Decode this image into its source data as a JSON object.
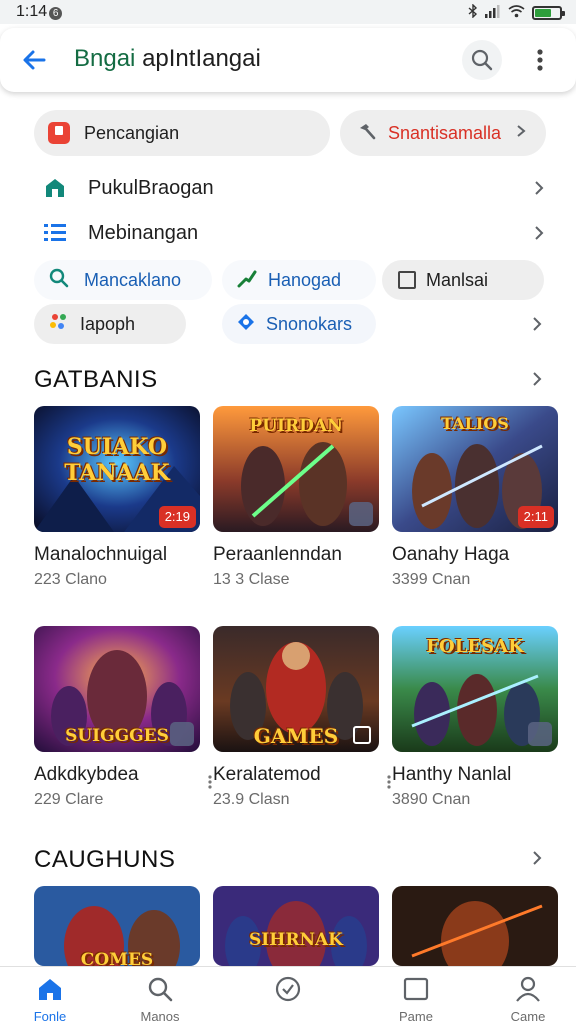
{
  "status": {
    "time": "1:14",
    "time_badge": "6",
    "signal_text": "✱ .ıl"
  },
  "header": {
    "title_part1": "Bngai",
    "title_part2": "apIntIangai"
  },
  "chips": {
    "primary": "Pencangian",
    "secondary": "Snantisamalla"
  },
  "rows": [
    {
      "label": "PukulBraogan"
    },
    {
      "label": "Mebinangan"
    }
  ],
  "filters": [
    {
      "label": "Mancaklano"
    },
    {
      "label": "Hanogad"
    },
    {
      "label": "Manlsai"
    },
    {
      "label": "Iapoph"
    },
    {
      "label": "Snonokars"
    }
  ],
  "sections": [
    {
      "title": "GATBANIS",
      "items": [
        {
          "title": "Manalochnuigal",
          "sub": "223 Clano",
          "badge": "2:19",
          "art": "SUIAKO TANAAK"
        },
        {
          "title": "Peraanlenndan",
          "sub": "13 3 Clase",
          "badge": "",
          "art": "PUIRDAN"
        },
        {
          "title": "Oanahy Haga",
          "sub": "3399 Cnan",
          "badge": "2:11",
          "art": "TALIOS"
        },
        {
          "title": "Adkdkybdea",
          "sub": "229 Clare",
          "badge": "",
          "art": "SUIGGGES"
        },
        {
          "title": "Keralatemod",
          "sub": "23.9 Clasn",
          "badge": "",
          "art": "GAMES"
        },
        {
          "title": "Hanthy Nanlal",
          "sub": "3890 Cnan",
          "badge": "",
          "art": "FOLESAK"
        }
      ]
    },
    {
      "title": "CAUGHUNS",
      "items": [
        {
          "art": "COMES"
        },
        {
          "art": "SIHRNAK"
        },
        {
          "art": ""
        }
      ]
    }
  ],
  "bottom_nav": [
    {
      "label": "Fonle",
      "icon": "home-icon",
      "active": true
    },
    {
      "label": "Manos",
      "icon": "search-icon",
      "active": false
    },
    {
      "label": "",
      "icon": "check-circle-icon",
      "active": false
    },
    {
      "label": "Pame",
      "icon": "square-icon",
      "active": false
    },
    {
      "label": "Came",
      "icon": "person-icon",
      "active": false
    }
  ],
  "colors": {
    "accent": "#1a73e8",
    "title_green": "#146c43",
    "badge_red": "#d93025",
    "secondary_chip_text": "#d93025"
  }
}
